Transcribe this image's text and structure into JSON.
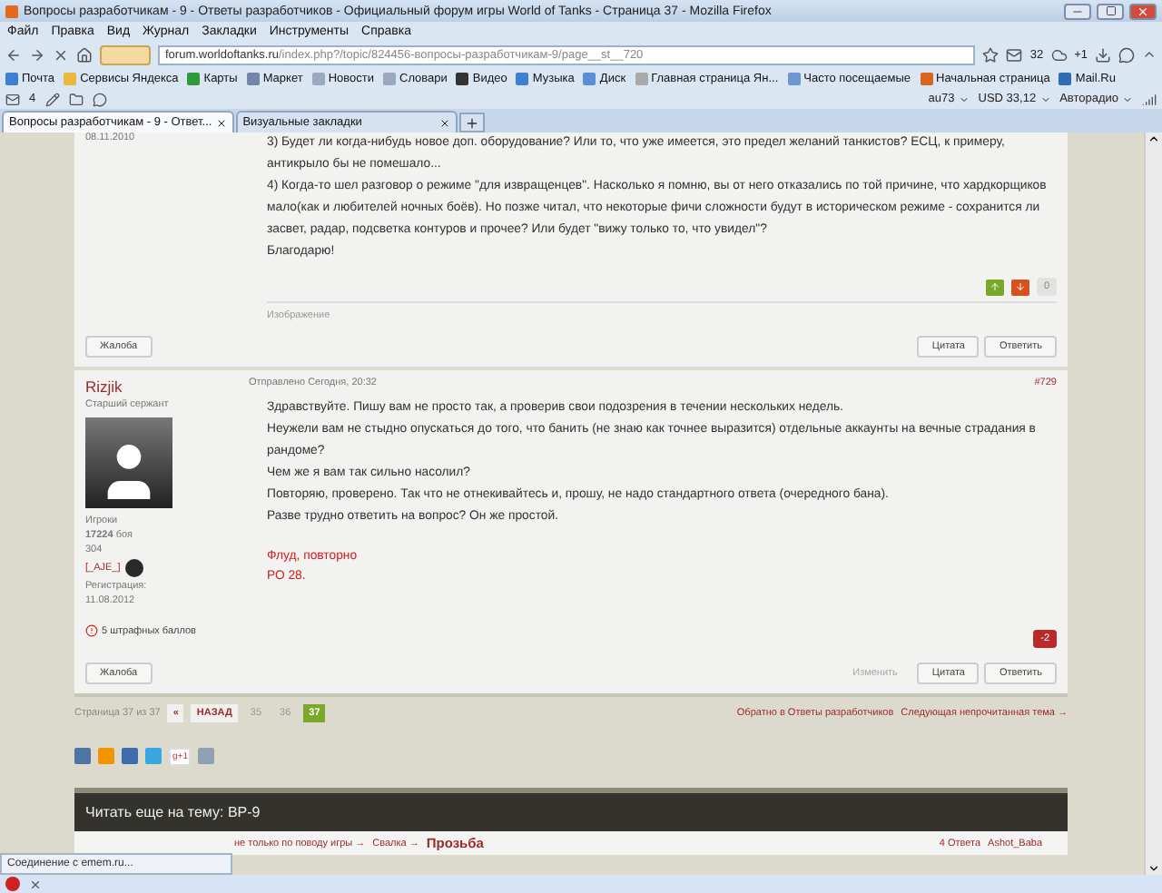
{
  "window": {
    "title": "Вопросы разработчикам - 9 - Ответы разработчиков - Официальный форум игры World of Tanks - Страница 37 - Mozilla Firefox"
  },
  "menu": [
    "Файл",
    "Правка",
    "Вид",
    "Журнал",
    "Закладки",
    "Инструменты",
    "Справка"
  ],
  "nav": {
    "url_host": "forum.worldoftanks.ru",
    "url_path": "/index.php?/topic/824456-вопросы-разработчикам-9/page__st__720",
    "mail_count": "32",
    "weather": "+1"
  },
  "bookmarks": [
    "Почта",
    "Сервисы Яндекса",
    "Карты",
    "Маркет",
    "Новости",
    "Словари",
    "Видео",
    "Музыка",
    "Диск",
    "Главная страница Ян...",
    "Часто посещаемые",
    "Начальная страница",
    "Mail.Ru"
  ],
  "yandex_bar": {
    "mail_count": "4",
    "widgets": [
      "au73",
      "USD 33,12",
      "Авторадио"
    ]
  },
  "tabs": [
    {
      "label": "Вопросы разработчикам - 9 - Ответ...",
      "selected": true
    },
    {
      "label": "Визуальные закладки",
      "selected": false
    }
  ],
  "posts": [
    {
      "date": "08.11.2010",
      "paragraphs": [
        "3) Будет ли когда-нибудь новое доп. оборудование? Или то, что уже имеется, это предел желаний танкистов? ЕСЦ, к примеру, антикрыло бы не помешало...",
        "4) Когда-то шел разговор о режиме \"для извращенцев\". Насколько я помню, вы от него отказались по той причине, что хардкорщиков мало(как и любителей ночных боёв). Но позже читал, что некоторые фичи сложности будут в историческом режиме - сохранится ли засвет, радар, подсветка контуров и прочее? Или будет \"вижу только то, что увидел\"?",
        "Благодарю!"
      ],
      "vote_buttons": true,
      "rating": {
        "value": "0",
        "negative": false
      },
      "signature": "Изображение",
      "buttons": [
        {
          "label": "Жалоба",
          "disabled": false
        },
        {
          "label": "Цитата",
          "disabled": false
        },
        {
          "label": "Ответить",
          "disabled": false
        }
      ]
    },
    {
      "author": {
        "name": "Rizjik",
        "rank": "Старший сержант",
        "group": "Игроки",
        "battles": "17224",
        "battles_label": "боя",
        "posts": "304",
        "clan": "[_AJE_]",
        "reg_label": "Регистрация:",
        "reg_date": "11.08.2012",
        "warning": "5 штрафных баллов"
      },
      "posted": "Отправлено Сегодня, 20:32",
      "number": "#729",
      "paragraphs": [
        "Здравствуйте. Пишу вам не просто так, а проверив свои подозрения в течении нескольких недель.",
        "Неужели вам не стыдно опускаться до того, что банить (не знаю как точнее выразится) отдельные аккаунты на вечные страдания в рандоме?",
        "Чем же я вам так сильно насолил?",
        "Повторяю, проверено. Так что не отнекивайтесь и, прошу, не надо стандартного ответа (очередного бана).",
        "Разве трудно ответить на вопрос? Он же простой."
      ],
      "notes": [
        "Флуд, повторно",
        "РО 28."
      ],
      "vote_buttons": false,
      "rating": {
        "value": "-2",
        "negative": true
      },
      "buttons": [
        {
          "label": "Жалоба",
          "disabled": false
        },
        {
          "label": "Изменить",
          "disabled": true
        },
        {
          "label": "Цитата",
          "disabled": false
        },
        {
          "label": "Ответить",
          "disabled": false
        }
      ]
    }
  ],
  "pagination": {
    "label": "Страница 37 из 37",
    "first": "«",
    "back": "НАЗАД",
    "pages": [
      {
        "label": "35",
        "selected": false
      },
      {
        "label": "36",
        "selected": false
      },
      {
        "label": "37",
        "selected": true
      }
    ],
    "links": [
      "Обратно в Ответы разработчиков",
      "Следующая непрочитанная тема →"
    ]
  },
  "share": {
    "gplus": "g+1"
  },
  "read_more": {
    "title": "Читать еще на тему: ВР-9",
    "breadcrumb": [
      "не только по поводу игры →",
      "Свалка →"
    ],
    "topic": "Прозьба",
    "replies": "4 Ответа",
    "author": "Ashot_Baba"
  },
  "status": "Соединение с emem.ru..."
}
